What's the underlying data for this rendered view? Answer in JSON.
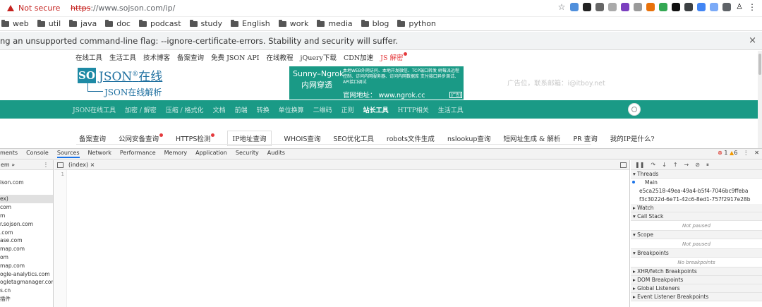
{
  "addressbar": {
    "security_text": "Not secure",
    "url_scheme": "https",
    "url_rest": "://www.sojson.com/ip/"
  },
  "extensions": [
    {
      "icon": "star-icon",
      "color": "#5f6368"
    },
    {
      "icon": "ext-icon-1",
      "color": "#4f8fdc"
    },
    {
      "icon": "ext-icon-2",
      "color": "#222222"
    },
    {
      "icon": "ext-icon-3",
      "color": "#666666"
    },
    {
      "icon": "ext-icon-4",
      "color": "#aaaaaa"
    },
    {
      "icon": "ext-icon-5",
      "color": "#7b3fbf"
    },
    {
      "icon": "ext-icon-6",
      "color": "#9a9a9a"
    },
    {
      "icon": "ext-icon-7",
      "color": "#e8710a"
    },
    {
      "icon": "ext-icon-8",
      "color": "#34a853"
    },
    {
      "icon": "ext-icon-9",
      "color": "#111111"
    },
    {
      "icon": "ext-icon-10",
      "color": "#3c4043"
    },
    {
      "icon": "ext-icon-11",
      "color": "#4285f4"
    },
    {
      "icon": "ext-icon-12",
      "color": "#7baaf7"
    },
    {
      "icon": "ext-icon-13",
      "color": "#5f6368"
    },
    {
      "icon": "person-icon",
      "color": "#202124"
    },
    {
      "icon": "menu-icon",
      "color": "#202124"
    }
  ],
  "bookmarks": [
    "web",
    "util",
    "java",
    "doc",
    "podcast",
    "study",
    "English",
    "work",
    "media",
    "blog",
    "python"
  ],
  "infobar": {
    "text": "ng an unsupported command-line flag: --ignore-certificate-errors. Stability and security will suffer.",
    "close": "×"
  },
  "site": {
    "topnav": [
      "在线工具",
      "生活工具",
      "技术博客",
      "备案查询",
      "免费 JSON API",
      "在线教程",
      "jQuery下载",
      "CDN加速"
    ],
    "topnav_hot": "JS 解密",
    "logo_so": "SO",
    "logo_json": "JSON",
    "logo_mark": "®",
    "logo_zx": "在线",
    "logo_sub": "JSON在线解析",
    "banner_title1": "Sunny–Ngrok",
    "banner_title2": "内网穿透",
    "banner_desc": "本地WEB外网访问、本地开发微信、TCP端口转发 树莓派远程控制、访问内网服务器、访问内网数据库 支付接口异步调试、API接口调试",
    "banner_site": "官网地址：  www.ngrok.cc",
    "banner_ad": "[广告]",
    "ad_text": "广告位，联系邮箱：i@itboy.net",
    "greennav": [
      "JSON在线工具",
      "加密 / 解密",
      "压缩 / 格式化",
      "文档",
      "前端",
      "转换",
      "单位换算",
      "二维码",
      "正则"
    ],
    "greennav_active": "站长工具",
    "greennav_after": [
      "HTTP相关",
      "生活工具"
    ],
    "subnav": [
      {
        "label": "备案查询",
        "hot": false,
        "sans": false
      },
      {
        "label": "公网安备查询",
        "hot": true,
        "sans": false
      },
      {
        "label": "HTTPS检测",
        "hot": true,
        "sans": true
      },
      {
        "label": "IP地址查询",
        "hot": false,
        "sans": false,
        "active": true
      },
      {
        "label": "WHOIS查询",
        "hot": false,
        "sans": true
      },
      {
        "label": "SEO优化工具",
        "hot": false,
        "sans": true
      },
      {
        "label": "robots文件生成",
        "hot": false,
        "sans": true
      },
      {
        "label": "nslookup查询",
        "hot": false,
        "sans": true
      },
      {
        "label": "短网址生成 & 解析",
        "hot": false,
        "sans": false
      },
      {
        "label": "PR 查询",
        "hot": false,
        "sans": true
      },
      {
        "label": "我的IP是什么?",
        "hot": false,
        "sans": false
      }
    ]
  },
  "devtools": {
    "tabs": [
      "ments",
      "Console",
      "Sources",
      "Network",
      "Performance",
      "Memory",
      "Application",
      "Security",
      "Audits"
    ],
    "active_tab": "Sources",
    "errors": "1",
    "warnings": "6",
    "left_header": "em",
    "left_more": "»",
    "left_items": [
      "",
      "ison.com",
      "",
      "ex)",
      "com",
      "m",
      "r.sojson.com",
      ".com",
      "ase.com",
      "map.com",
      "om",
      "map.com",
      "ogle-analytics.com",
      "ogletagmanager.com",
      "s.cn",
      "插件"
    ],
    "left_selected": 3,
    "editor_tab": "(index) ×",
    "line_number": "1",
    "threads_title": "Threads",
    "thread_main": "Main",
    "thread_ids": [
      "e5ca2518-49ea-49a4-b5f4-7046bc9ffeba",
      "f3c3022d-6e71-42c6-8ed1-757f2917e28b"
    ],
    "sections": [
      "Watch",
      "Call Stack",
      "Scope",
      "Breakpoints",
      "XHR/fetch Breakpoints",
      "DOM Breakpoints",
      "Global Listeners",
      "Event Listener Breakpoints"
    ],
    "not_paused": "Not paused",
    "no_breakpoints": "No breakpoints"
  }
}
